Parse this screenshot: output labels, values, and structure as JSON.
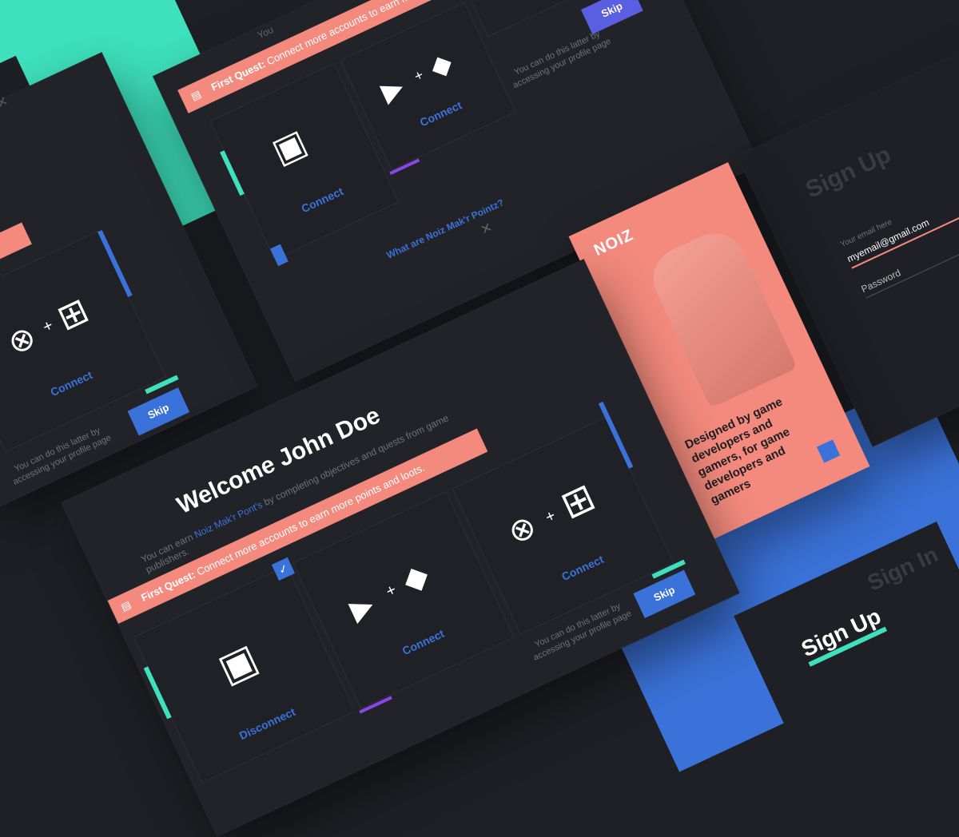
{
  "colors": {
    "teal": "#3ee0bd",
    "coral": "#f38a7d",
    "blue": "#3b72d9",
    "purple": "#8a45e8",
    "bg": "#1f2025",
    "panel": "#222328"
  },
  "main": {
    "title": "Welcome John Doe",
    "subtitle_pre": "You can earn ",
    "subtitle_link": "Noiz Mak'r Pont's",
    "subtitle_post": " by completing objectives and quests from game publishers.",
    "quest_label": "First Quest:",
    "quest_text": "Connect more accounts to earn more points and loots.",
    "cards": [
      {
        "service": "twitch-icon",
        "action": "Disconnect",
        "checked": true
      },
      {
        "service": "youtube-plus-gamepad",
        "action": "Connect"
      },
      {
        "service": "xbox-plus-windows",
        "action": "Connect"
      }
    ],
    "later_text": "You can do this latter by accessing your profile page",
    "skip_label": "Skip"
  },
  "top": {
    "quest_label": "First Quest:",
    "quest_text": "Connect more accounts to earn more points and loots.",
    "twitch_action": "Connect",
    "youtube_action": "Connect",
    "xbox_action": "Connect",
    "later_text": "You can do this latter by accessing your profile page",
    "skip_label": "Skip",
    "help_link": "What are Noiz Mak'r Pointz?",
    "header_fragment": "You"
  },
  "left": {
    "action": "Connect",
    "later_text": "You can do this latter by accessing your profile page",
    "skip_label": "Skip"
  },
  "promo": {
    "logo": "NOIZ",
    "tagline": "Designed by game developers and gamers, for game developers and gamers"
  },
  "signup": {
    "heading": "Sign Up",
    "email_label": "Your email here",
    "email_value": "myemail@gmail.com",
    "password_placeholder": "Password",
    "signin_fragment": "Sign In",
    "heading_bottom": "Sign Up"
  }
}
